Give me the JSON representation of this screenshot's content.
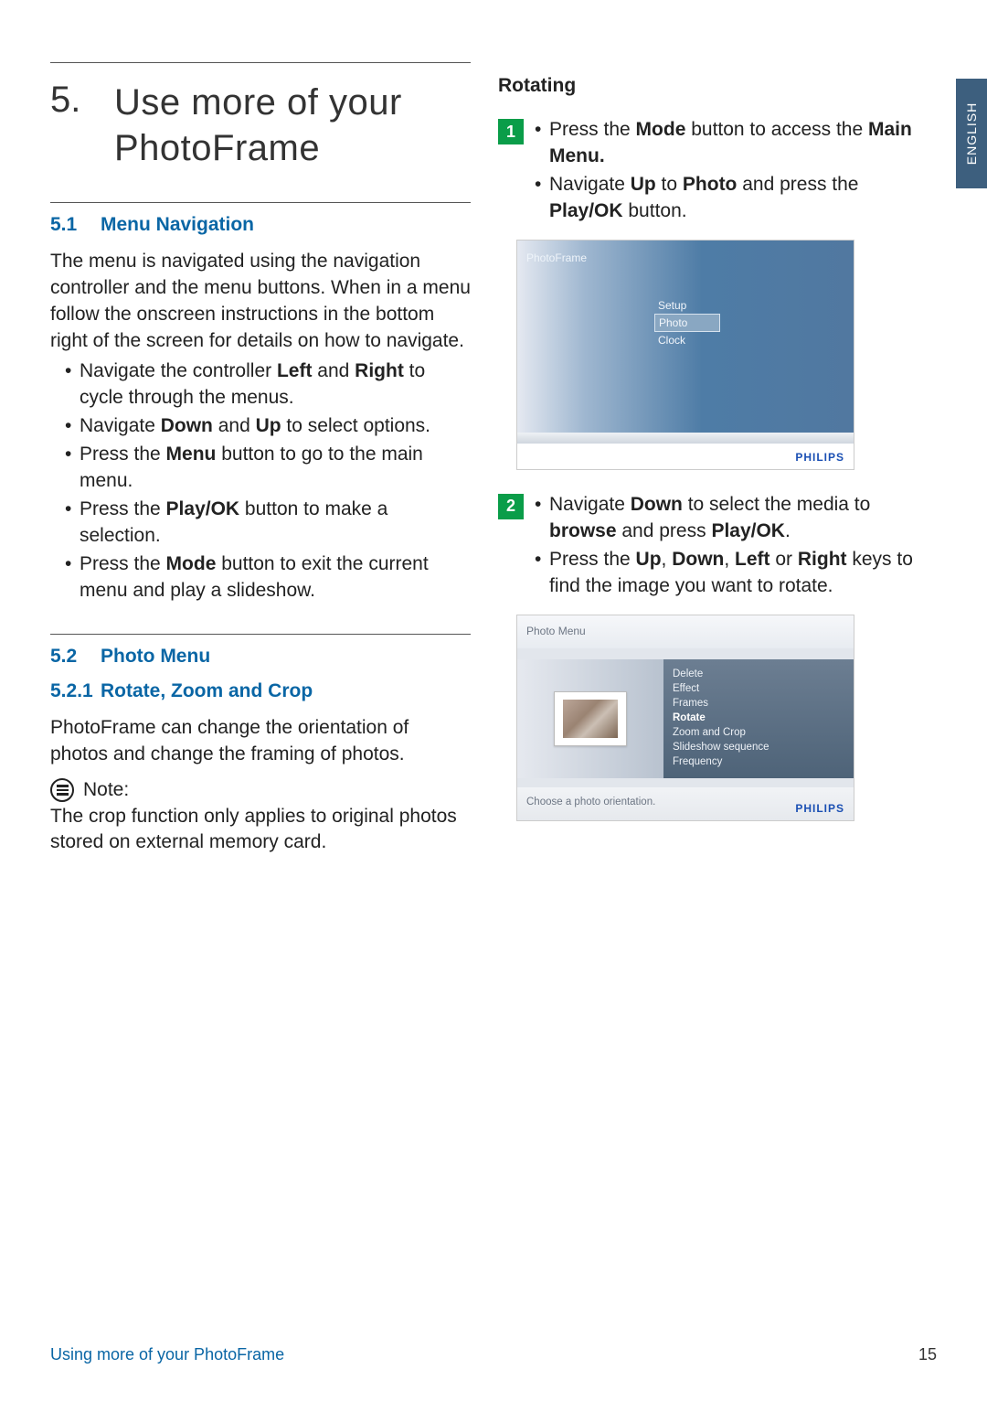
{
  "sideTab": "ENGLISH",
  "chapter": {
    "num": "5.",
    "title1": "Use more of your",
    "title2": "PhotoFrame"
  },
  "s51": {
    "num": "5.1",
    "title": "Menu Navigation",
    "para": "The menu is navigated using the navigation controller and the menu buttons. When in a menu follow the onscreen instructions in the bottom right of the screen for details on how to navigate.",
    "b1a": "Navigate the controller ",
    "b1b": "Left",
    "b1c": " and ",
    "b1d": "Right",
    "b1e": " to cycle through the menus.",
    "b2a": "Navigate ",
    "b2b": "Down",
    "b2c": " and ",
    "b2d": "Up",
    "b2e": " to select options.",
    "b3a": "Press the ",
    "b3b": "Menu",
    "b3c": " button to go to the main menu.",
    "b4a": "Press the ",
    "b4b": "Play/OK",
    "b4c": " button to make a selection.",
    "b5a": "Press the ",
    "b5b": "Mode",
    "b5c": " button to exit the current menu and play a slideshow."
  },
  "s52": {
    "num": "5.2",
    "title": "Photo Menu"
  },
  "s521": {
    "num": "5.2.1",
    "title": "Rotate, Zoom and Crop",
    "para": "PhotoFrame can change the orientation of photos and change the framing of photos."
  },
  "note": {
    "label": "Note:",
    "text": "The crop function only applies to original photos stored on external memory card."
  },
  "right": {
    "heading": "Rotating",
    "step1": {
      "n": "1",
      "a1": "Press the ",
      "a2": "Mode",
      "a3": " button to access the ",
      "a4": "Main Menu.",
      "b1": "Navigate ",
      "b2": "Up",
      "b3": " to ",
      "b4": "Photo",
      "b5": " and press the ",
      "b6": "Play/OK",
      "b7": " button."
    },
    "step2": {
      "n": "2",
      "a1": "Navigate ",
      "a2": "Down",
      "a3": " to select the media to ",
      "a4": "browse",
      "a5": " and press ",
      "a6": "Play/OK",
      "a7": ".",
      "b1": "Press the ",
      "b2": "Up",
      "b3": ", ",
      "b4": "Down",
      "b5": ", ",
      "b6": "Left",
      "b7": " or ",
      "b8": "Right",
      "b9": " keys to find the image you want to rotate."
    }
  },
  "shot1": {
    "title": "PhotoFrame",
    "m1": "Setup",
    "m2": "Photo",
    "m3": "Clock",
    "brand": "PHILIPS"
  },
  "shot2": {
    "title": "Photo Menu",
    "i1": "Delete",
    "i2": "Effect",
    "i3": "Frames",
    "i4": "Rotate",
    "i5": "Zoom and Crop",
    "i6": "Slideshow sequence",
    "i7": "Frequency",
    "cap": "Choose a photo orientation.",
    "brand": "PHILIPS"
  },
  "footer": {
    "left": "Using more of your PhotoFrame",
    "page": "15"
  }
}
